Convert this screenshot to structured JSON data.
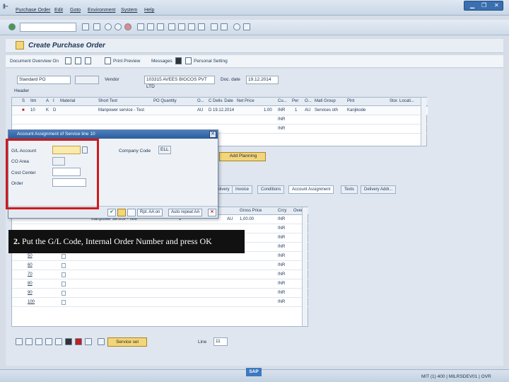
{
  "menu": {
    "items": [
      "Purchase Order",
      "Edit",
      "Goto",
      "Environment",
      "System",
      "Help"
    ]
  },
  "title": "Create Purchase Order",
  "app_toolbar": {
    "doc_overview": "Document Overview On",
    "print_preview": "Print Preview",
    "messages": "Messages",
    "personal_setting": "Personal Setting"
  },
  "header": {
    "doc_type": "Standard PO",
    "vendor_label": "Vendor",
    "vendor_value": "103315 AVEES BIOCOS PVT LTD",
    "doc_date_label": "Doc. date",
    "doc_date_value": "19.12.2014",
    "header_label": "Header"
  },
  "items_grid": {
    "columns": [
      "S",
      "Itm",
      "A",
      "I",
      "Material",
      "Short Text",
      "PO Quantity",
      "O...",
      "C",
      "Deliv. Date",
      "Net Price",
      "Cu...",
      "Per",
      "O...",
      "Matl Group",
      "Plnt",
      "Stor. Locati..."
    ],
    "rows": [
      {
        "itm": "10",
        "a": "K",
        "i": "D",
        "short_text": "Manpower service - Test",
        "ouan": "AU",
        "c": "D",
        "deliv": "19.12.2014",
        "net": "1.00",
        "cu": "INR",
        "per": "1",
        "ou": "AU",
        "matl": "Services oth",
        "plnt": "Kanjikode"
      },
      {
        "cu": "INR"
      },
      {
        "cu": "INR"
      }
    ]
  },
  "dialog": {
    "title": "Account Assignment of Service line 10",
    "gl_account": "G/L Account",
    "co_area": "CO Area",
    "cost_center": "Cost Center",
    "order": "Order",
    "company_code": "Company Code",
    "company_code_value": "ELL",
    "btn_rpt_aa_on": "Rpt. AA on",
    "btn_auto_repeat": "Auto repeat AA"
  },
  "add_planning": "Add Planning",
  "tabs2": [
    "Delivery",
    "Invoice",
    "Conditions",
    "Account Assignment",
    "Texts",
    "Delivery Addr..."
  ],
  "services_grid": {
    "col_gross_price": "Gross Price",
    "col_crcy": "Crcy",
    "col_over": "Over",
    "first_short_text": "Manpower service - Test",
    "first_qty": "1",
    "first_unit": "AU",
    "first_price": "1,00.00",
    "line_numbers": [
      "50",
      "60",
      "70",
      "80",
      "90",
      "100"
    ],
    "crcy_values": [
      "INR",
      "INR",
      "INR",
      "INR",
      "INR",
      "INR",
      "INR",
      "INR",
      "INR",
      "INR"
    ]
  },
  "bottom": {
    "service_sel": "Service sel",
    "line_label": "Line",
    "line_value": "11"
  },
  "callout": {
    "step": "2.",
    "text": "Put the G/L Code, Internal Order Number and press OK"
  },
  "status": {
    "system": "MIT (1) 400",
    "server": "MILRSDEV01",
    "mode": "OVR"
  },
  "colors": {
    "accent": "#3a6fb0",
    "highlight": "#d11a1a",
    "required": "#fbeab0"
  }
}
